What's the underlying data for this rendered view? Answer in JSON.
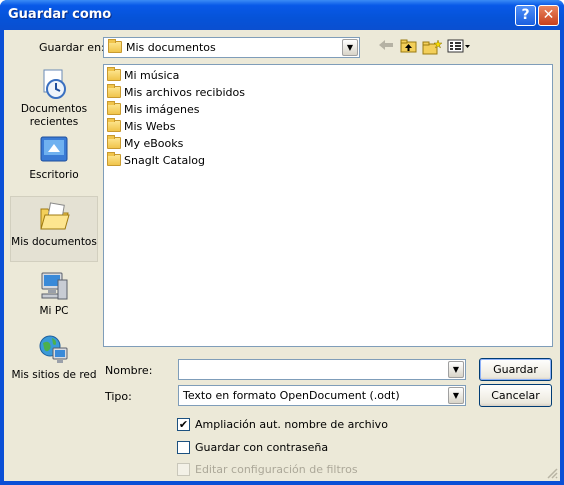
{
  "window": {
    "title": "Guardar como",
    "help_glyph": "?",
    "close_glyph": "✕"
  },
  "location": {
    "label": "Guardar en:",
    "value": "Mis documentos",
    "dropdown_glyph": "▼",
    "toolbar_icons": [
      "back-icon",
      "up-folder-icon",
      "new-folder-icon",
      "views-menu-icon"
    ]
  },
  "places": [
    {
      "label": "Documentos recientes",
      "icon": "recent-documents-icon"
    },
    {
      "label": "Escritorio",
      "icon": "desktop-icon"
    },
    {
      "label": "Mis documentos",
      "icon": "my-documents-icon",
      "selected": true
    },
    {
      "label": "Mi PC",
      "icon": "my-computer-icon"
    },
    {
      "label": "Mis sitios de red",
      "icon": "network-places-icon"
    }
  ],
  "files": [
    {
      "name": "Mi música",
      "icon": "music-folder-icon"
    },
    {
      "name": "Mis archivos recibidos",
      "icon": "folder-icon"
    },
    {
      "name": "Mis imágenes",
      "icon": "pictures-folder-icon"
    },
    {
      "name": "Mis Webs",
      "icon": "web-folder-icon"
    },
    {
      "name": "My eBooks",
      "icon": "folder-icon"
    },
    {
      "name": "SnagIt Catalog",
      "icon": "folder-icon"
    }
  ],
  "form": {
    "name_label": "Nombre:",
    "name_value": "",
    "type_label": "Tipo:",
    "type_value": "Texto en formato OpenDocument (.odt)",
    "save_button": "Guardar",
    "cancel_button": "Cancelar"
  },
  "options": [
    {
      "label": "Ampliación aut. nombre de archivo",
      "checked": true,
      "enabled": true
    },
    {
      "label": "Guardar con contraseña",
      "checked": false,
      "enabled": true
    },
    {
      "label": "Editar configuración de filtros",
      "checked": false,
      "enabled": false
    }
  ],
  "colors": {
    "titlebar": "#0a4fd6",
    "dialog_bg": "#ece9d8",
    "close_button": "#c8401c",
    "border": "#7f9db9"
  }
}
